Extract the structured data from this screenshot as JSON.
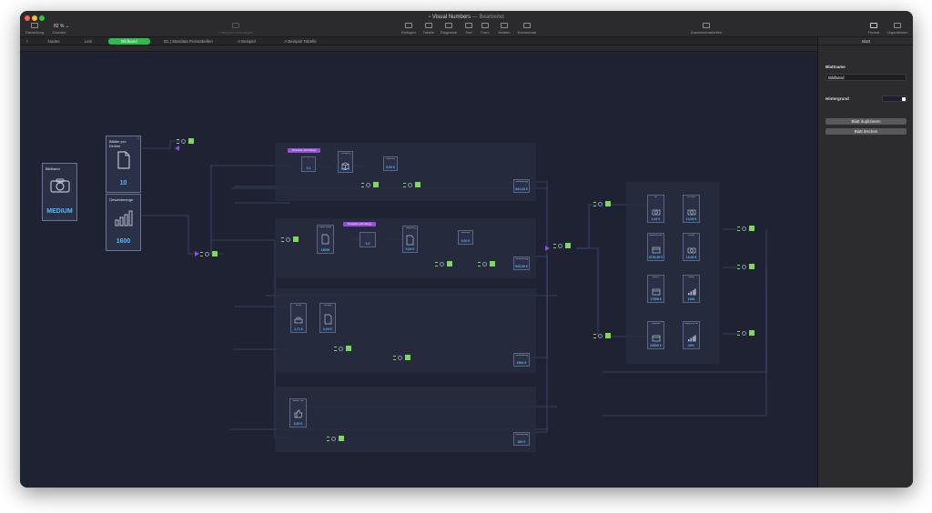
{
  "window": {
    "title": "Visual Numbers",
    "subtitle": "— Bearbeitet",
    "traffic_lights": [
      "#ff5f57",
      "#febc2e",
      "#28c840"
    ]
  },
  "toolbar": {
    "darstellung": "Darstellung",
    "zoom_value": "82 %",
    "zoom_label": "Zoomen",
    "kategorie": "Kategorie hinzufügen",
    "einfuegen": "Einfügen",
    "tabelle": "Tabelle",
    "diagramm": "Diagramm",
    "text": "Text",
    "form": "Form",
    "medien": "Medien",
    "kommentar": "Kommentar",
    "zusammenarbeiten": "Zusammenarbeiten",
    "format": "Format",
    "organisieren": "Organisieren"
  },
  "tabs": {
    "add": "+",
    "items": [
      "Nodes",
      "Lem",
      "Bildband",
      "B1 | Mandala Preistabellen",
      "A Beispiel",
      "A Beispiel Tabelle"
    ],
    "active": "Bildband"
  },
  "nodes": {
    "product": {
      "label": "Bildband",
      "value": "MEDIUM",
      "icon": "camera-icon"
    },
    "pages": {
      "label": "Blätter pro Einheit",
      "value": "10",
      "icon": "document-icon"
    },
    "quantity": {
      "label": "Gesamtmenge",
      "value": "1600",
      "icon": "bar-chart-icon"
    },
    "tag1": "Preisstufe nach Menge",
    "tag2": "Preisstufe nach Menge",
    "r1": {
      "a_val": "0.1",
      "b_label": "Versand",
      "b_val": "0,31 €",
      "c_label": "Lieferzeit",
      "c_val": "0,00 €",
      "out_label": "Gesamtpreis",
      "out_val": "541,33 €"
    },
    "r2": {
      "a_label": "Papier Blätter",
      "a_val": "16000",
      "b_val": "0.2",
      "c_label": "Blattpreis",
      "c_val": "0,04 €",
      "d_label": "Lieferzeit",
      "d_val": "0,00 €",
      "out_label": "Gesamtpreis",
      "out_val": "543,00 €"
    },
    "r3": {
      "a_label": "Druck",
      "a_val": "1,71 €",
      "b_label": "Bindung",
      "b_val": "0,03 €",
      "out_label": "Gesamtpreis",
      "out_val": "2904 €"
    },
    "r4": {
      "a_label": "Marke / Stk",
      "a_val": "0,20 €",
      "out_label": "Gesamtpreis",
      "out_val": "320 €"
    },
    "summary": [
      {
        "label": "Stk",
        "value": "2,10 €",
        "icon": "camera-icon"
      },
      {
        "label": "VK netto",
        "value": "13,00 €",
        "icon": "camera-icon"
      },
      {
        "label": "Gesamtkosten",
        "value": "4776,00 €",
        "icon": "card-icon"
      },
      {
        "label": "Umsatz",
        "value": "13,06 €",
        "icon": "camera-icon"
      },
      {
        "label": "Gewinn",
        "value": "17556 €",
        "icon": "card-icon"
      },
      {
        "label": "Marge",
        "value": "1400",
        "icon": "bar-chart-icon"
      },
      {
        "label": "Liquidität",
        "value": "24000 €",
        "icon": "card-icon"
      },
      {
        "label": "Marge pro Stk",
        "value": "20%",
        "icon": "bar-chart-icon"
      }
    ]
  },
  "inspector": {
    "header": "Blatt",
    "name_label": "Blattname",
    "name_value": "Bildband",
    "bg_label": "Hintergrund",
    "dup_button": "Blatt duplizieren",
    "delete_button": "Blatt löschen"
  },
  "colors": {
    "accent_green": "#2dbb4e",
    "node_green": "#7ed95a",
    "value_blue": "#55b7ff",
    "tag_purple": "#9a4ce0",
    "canvas": "#1e2233"
  }
}
